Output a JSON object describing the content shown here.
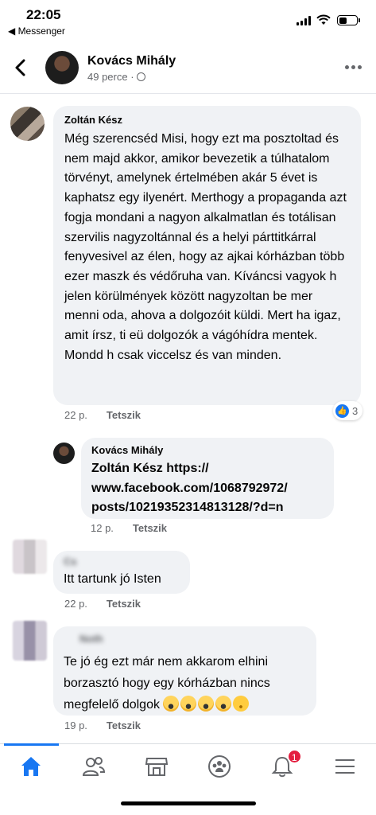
{
  "status_bar": {
    "time": "22:05",
    "back_app": "◀ Messenger"
  },
  "header": {
    "name": "Kovács Mihály",
    "subtitle": "49 perce ·"
  },
  "comments": [
    {
      "author": "Zoltán Kész",
      "text": "Még szerencséd Misi, hogy ezt ma posztoltad és nem majd akkor, amikor bevezetik a túlhatalom törvényt, amelynek értelmében akár 5 évet is kaphatsz egy ilyenért. Merthogy a propaganda azt fogja mondani a nagyon alkalmatlan és totálisan szervilis nagyzoltánnal és a helyi párttitkárral fenyvesivel az élen, hogy az ajkai kórházban több ezer maszk és védőruha van. Kíváncsi vagyok h jelen körülmények között nagyzoltan be mer menni oda, ahova a dolgozóit küldi. Mert ha igaz, amit írsz, ti eü dolgozók a vágóhídra mentek. Mondd h csak viccelsz és van minden.",
      "time": "22 p.",
      "like": "Tetszik",
      "reaction_count": "3"
    },
    {
      "author": "Kovács Mihály",
      "text": "Zoltán Kész https:// www.facebook.com/1068792972/ posts/10219352314813128/?d=n",
      "time": "12 p.",
      "like": "Tetszik"
    },
    {
      "author": "Cs",
      "text": "Itt tartunk jó Isten",
      "time": "22 p.",
      "like": "Tetszik"
    },
    {
      "author": "Noth",
      "text": "Te jó ég ezt már nem akkarom elhini borzasztó hogy egy kórházban nincs megfelelő dolgok",
      "time": "19 p.",
      "like": "Tetszik"
    }
  ],
  "nav": {
    "notification_count": "1"
  },
  "icons": [
    "back-arrow-icon",
    "globe-icon",
    "more-icon",
    "like-icon",
    "home-icon",
    "friends-icon",
    "marketplace-icon",
    "groups-icon",
    "bell-icon",
    "menu-icon"
  ],
  "colors": {
    "accent": "#1877f2",
    "badge": "#e41e3f",
    "bubble": "#f0f2f5"
  }
}
